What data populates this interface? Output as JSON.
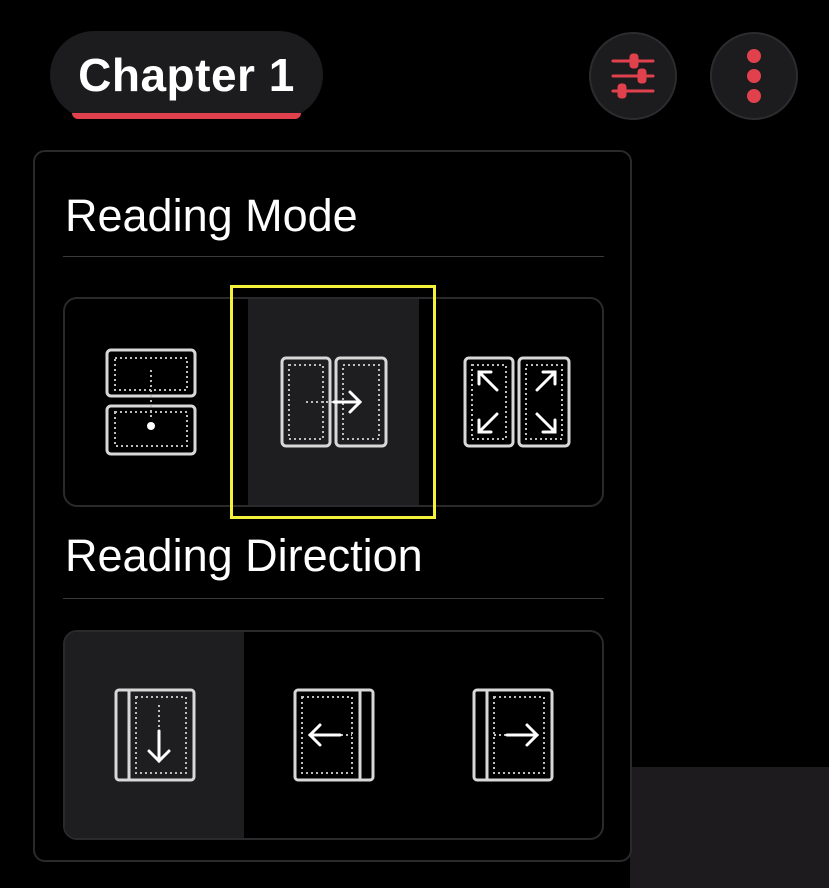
{
  "header": {
    "chapter_label": "Chapter 1",
    "accent_color": "#e0414c",
    "settings_icon": "sliders-icon",
    "more_icon": "more-vertical-icon"
  },
  "popover": {
    "reading_mode": {
      "title": "Reading Mode",
      "options": [
        {
          "icon": "vertical-scroll-mode-icon",
          "selected": false
        },
        {
          "icon": "paged-horizontal-mode-icon",
          "selected": true,
          "focused": true
        },
        {
          "icon": "fit-screen-mode-icon",
          "selected": false
        }
      ]
    },
    "reading_direction": {
      "title": "Reading Direction",
      "options": [
        {
          "icon": "top-to-bottom-direction-icon",
          "selected": true
        },
        {
          "icon": "right-to-left-direction-icon",
          "selected": false
        },
        {
          "icon": "left-to-right-direction-icon",
          "selected": false
        }
      ]
    }
  }
}
